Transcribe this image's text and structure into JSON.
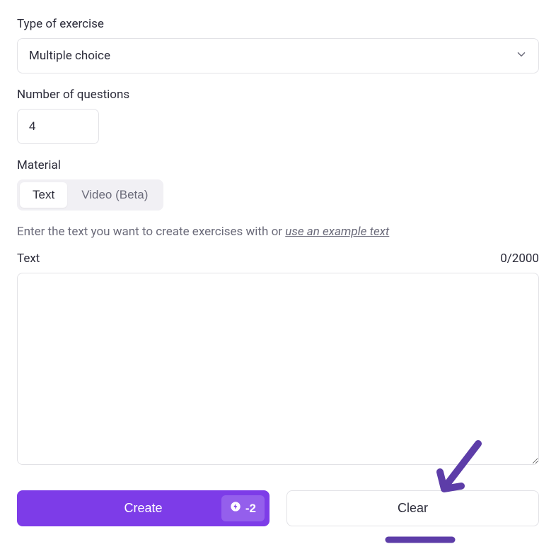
{
  "exerciseType": {
    "label": "Type of exercise",
    "value": "Multiple choice"
  },
  "numQuestions": {
    "label": "Number of questions",
    "value": "4"
  },
  "material": {
    "label": "Material",
    "tabs": [
      {
        "label": "Text",
        "active": true
      },
      {
        "label": "Video (Beta)",
        "active": false
      }
    ]
  },
  "hint": {
    "prefix": "Enter the text you want to create exercises with or ",
    "linkText": "use an example text"
  },
  "textArea": {
    "label": "Text",
    "count": "0/2000",
    "value": ""
  },
  "buttons": {
    "create": "Create",
    "cost": "-2",
    "clear": "Clear"
  },
  "colors": {
    "primary": "#7d3ce8",
    "annotation": "#5d3da8"
  }
}
